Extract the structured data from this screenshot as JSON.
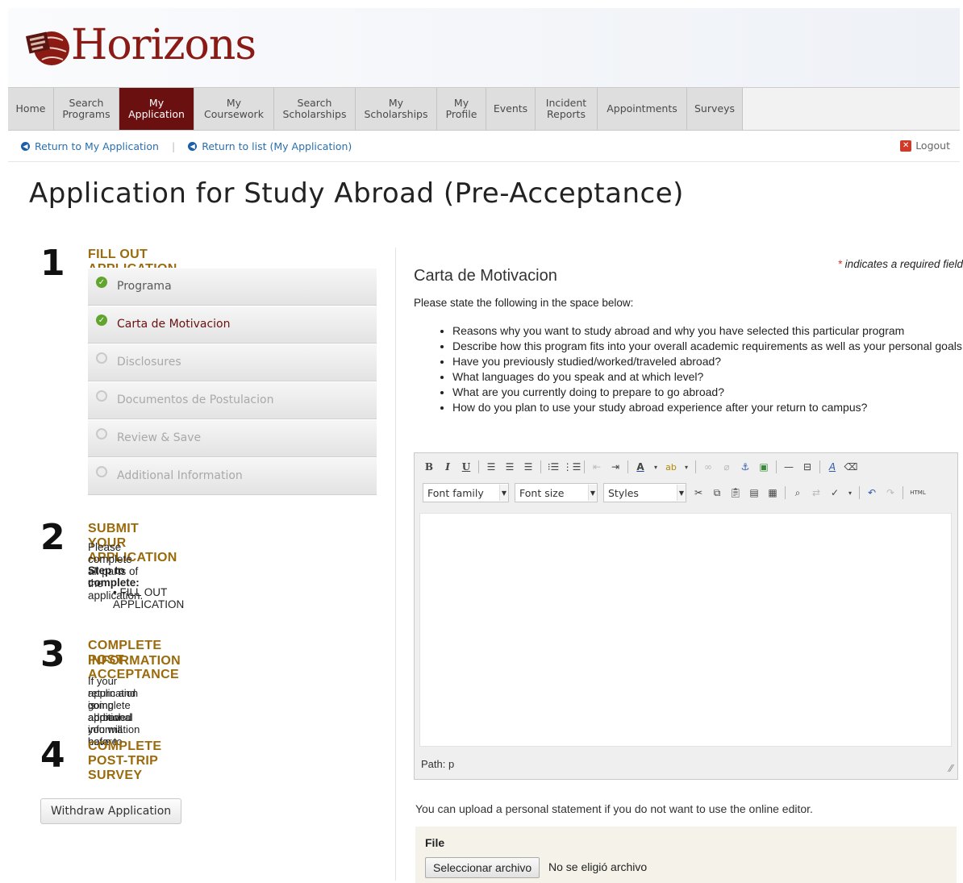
{
  "brand": {
    "name": "Horizons",
    "color": "#8b1a14"
  },
  "nav": {
    "items": [
      {
        "label": "Home"
      },
      {
        "label": "Search\nPrograms"
      },
      {
        "label": "My\nApplication",
        "active": true
      },
      {
        "label": "My\nCoursework"
      },
      {
        "label": "Search\nScholarships"
      },
      {
        "label": "My\nScholarships"
      },
      {
        "label": "My\nProfile"
      },
      {
        "label": "Events"
      },
      {
        "label": "Incident\nReports"
      },
      {
        "label": "Appointments"
      },
      {
        "label": "Surveys"
      }
    ]
  },
  "subbar": {
    "return_app": "Return to My Application",
    "return_list": "Return to list (My Application)",
    "separator": "|",
    "logout": "Logout"
  },
  "page_title": "Application for Study Abroad (Pre-Acceptance)",
  "steps": {
    "s1": {
      "num": "1",
      "title": "FILL OUT APPLICATION"
    },
    "s2": {
      "num": "2",
      "title": "SUBMIT YOUR APPLICATION",
      "text": "Please complete all parts of the application.",
      "sub": "Step to complete:",
      "item": "FILL OUT APPLICATION"
    },
    "s3": {
      "num": "3",
      "title_l1": "COMPLETE POST-ACCEPTANCE",
      "title_l2": "INFORMATION",
      "text_l1": "If your application is approved you will have to",
      "text_l2": "return and complete additional information before",
      "text_l3": "going abroad."
    },
    "s4": {
      "num": "4",
      "title": "COMPLETE POST-TRIP SURVEY"
    }
  },
  "sections": [
    {
      "label": "Programa",
      "status": "done"
    },
    {
      "label": "Carta de Motivacion",
      "status": "current"
    },
    {
      "label": "Disclosures",
      "status": "todo"
    },
    {
      "label": "Documentos de Postulacion",
      "status": "todo"
    },
    {
      "label": "Review & Save",
      "status": "todo"
    },
    {
      "label": "Additional Information",
      "status": "todo"
    }
  ],
  "withdraw_label": "Withdraw Application",
  "form": {
    "required_star": "*",
    "required_note": " indicates a required field",
    "title": "Carta de Motivacion",
    "intro": "Please state the following in the space below:",
    "bullets": [
      "Reasons why you want to study abroad and why you have selected this particular program",
      "Describe how this program fits into your overall academic requirements as well as your personal goals",
      "Have you previously studied/worked/traveled abroad?",
      "What languages do you speak and at which level?",
      "What are you currently doing to prepare to go abroad?",
      "How do you plan to use your study abroad experience after your return to campus?"
    ]
  },
  "editor": {
    "font_family": "Font family",
    "font_size": "Font size",
    "styles": "Styles",
    "path": "Path: p",
    "html_label": "HTML"
  },
  "upload": {
    "text": "You can upload a personal statement if you do not want to use the online editor.",
    "file_label": "File",
    "button": "Seleccionar archivo",
    "no_file": "No se eligió archivo"
  }
}
